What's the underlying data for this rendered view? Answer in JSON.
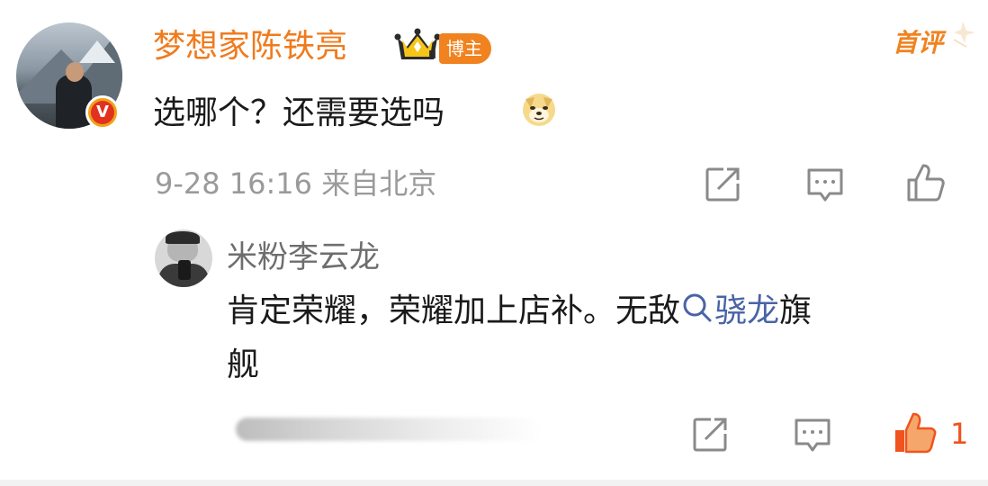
{
  "main_comment": {
    "username": "梦想家陈铁亮",
    "badge_label": "博主",
    "first_review_label": "首评",
    "text": "选哪个？还需要选吗",
    "meta": "9-28 16:16 来自北京",
    "emoji": "doge-emoji",
    "verified_icon": "v-verified-icon"
  },
  "reply": {
    "username": "米粉李云龙",
    "text_before_link": "肯定荣耀，荣耀加上店补。无敌",
    "link_text": "骁龙",
    "text_after_link": "旗",
    "text_line2": "舰",
    "like_count": "1"
  },
  "colors": {
    "username": "#f07b1d",
    "badge": "#f08320",
    "link": "#4a63a6",
    "liked": "#f0531d",
    "meta": "#9a9a9a"
  }
}
